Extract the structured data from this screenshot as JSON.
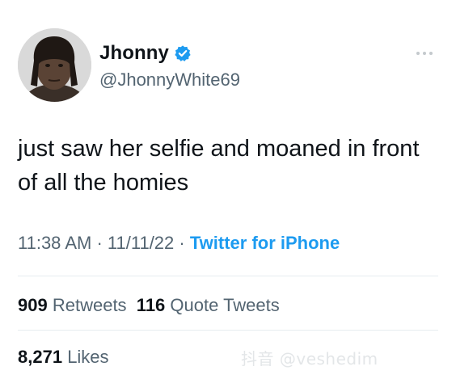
{
  "user": {
    "display_name": "Jhonny",
    "handle": "@JhonnyWhite69",
    "verified": true
  },
  "tweet": {
    "text": "just saw her selfie and moaned in front of all the homies",
    "time": "11:38 AM",
    "date": "11/11/22",
    "separator": "·",
    "source": "Twitter for iPhone"
  },
  "stats": {
    "retweets_count": "909",
    "retweets_label": "Retweets",
    "quotes_count": "116",
    "quotes_label": "Quote Tweets",
    "likes_count": "8,271",
    "likes_label": "Likes"
  },
  "icons": {
    "verified": "verified-badge-icon",
    "more": "more-options-icon",
    "avatar": "profile-avatar"
  },
  "colors": {
    "accent": "#1d9bf0",
    "text": "#0f1419",
    "muted": "#536471",
    "divider": "#e6ecf0"
  },
  "watermark": "抖音 @veshedim"
}
